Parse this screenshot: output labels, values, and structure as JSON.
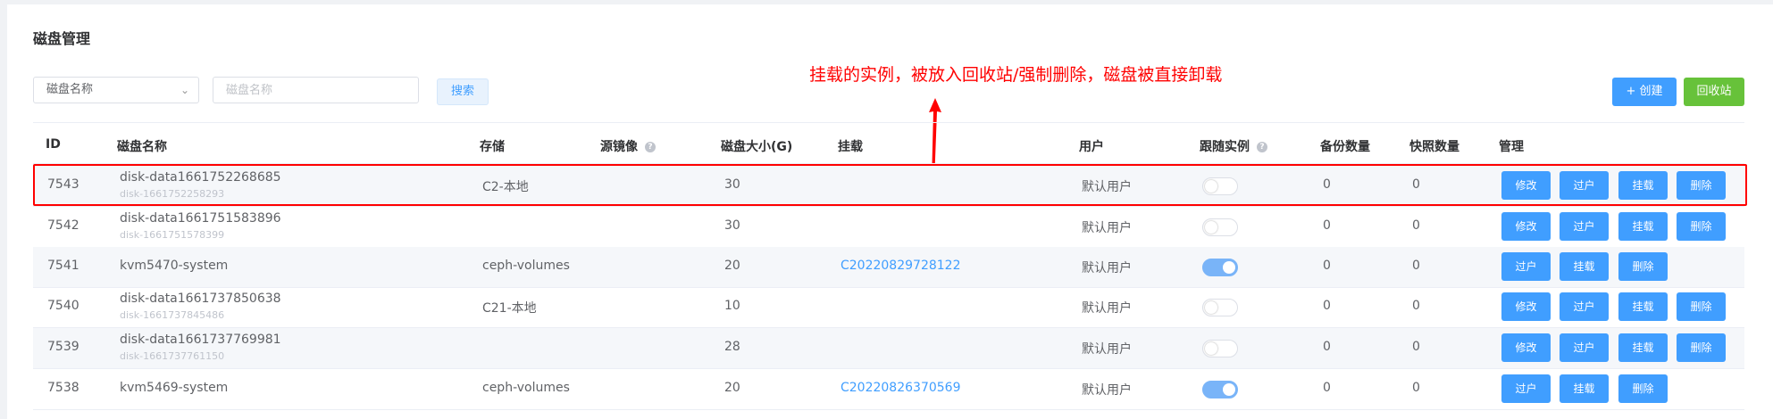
{
  "page": {
    "title": "磁盘管理"
  },
  "filter": {
    "select_value": "磁盘名称",
    "input_placeholder": "磁盘名称",
    "search_label": "搜索"
  },
  "toolbar": {
    "create_label": "+ 创建",
    "recycle_label": "回收站"
  },
  "annotation": {
    "text": "挂载的实例，被放入回收站/强制删除，磁盘被直接卸载",
    "color": "#ff0000"
  },
  "colors": {
    "primary": "#409eff",
    "success": "#67c23a"
  },
  "table": {
    "columns": {
      "id": "ID",
      "name": "磁盘名称",
      "storage": "存储",
      "source": "源镜像",
      "size": "磁盘大小(G)",
      "mount": "挂载",
      "user": "用户",
      "follow": "跟随实例",
      "backup": "备份数量",
      "snapshot": "快照数量",
      "manage": "管理"
    },
    "action_labels": {
      "edit": "修改",
      "transfer": "过户",
      "mount": "挂载",
      "delete": "删除"
    },
    "rows": [
      {
        "id": "7543",
        "name": "disk-data1661752268685",
        "sub": "disk-1661752258293",
        "storage": "C2-本地",
        "size": "30",
        "mount": "",
        "user": "默认用户",
        "follow": false,
        "backup": "0",
        "snapshot": "0",
        "actions": [
          "修改",
          "过户",
          "挂载",
          "删除"
        ]
      },
      {
        "id": "7542",
        "name": "disk-data1661751583896",
        "sub": "disk-1661751578399",
        "storage": "",
        "size": "30",
        "mount": "",
        "user": "默认用户",
        "follow": false,
        "backup": "0",
        "snapshot": "0",
        "actions": [
          "修改",
          "过户",
          "挂载",
          "删除"
        ]
      },
      {
        "id": "7541",
        "name": "kvm5470-system",
        "sub": "",
        "storage": "ceph-volumes",
        "size": "20",
        "mount": "C20220829728122",
        "user": "默认用户",
        "follow": true,
        "backup": "0",
        "snapshot": "0",
        "actions": [
          "过户",
          "挂载",
          "删除"
        ]
      },
      {
        "id": "7540",
        "name": "disk-data1661737850638",
        "sub": "disk-1661737845486",
        "storage": "C21-本地",
        "size": "10",
        "mount": "",
        "user": "默认用户",
        "follow": false,
        "backup": "0",
        "snapshot": "0",
        "actions": [
          "修改",
          "过户",
          "挂载",
          "删除"
        ]
      },
      {
        "id": "7539",
        "name": "disk-data1661737769981",
        "sub": "disk-1661737761150",
        "storage": "",
        "size": "28",
        "mount": "",
        "user": "默认用户",
        "follow": false,
        "backup": "0",
        "snapshot": "0",
        "actions": [
          "修改",
          "过户",
          "挂载",
          "删除"
        ]
      },
      {
        "id": "7538",
        "name": "kvm5469-system",
        "sub": "",
        "storage": "ceph-volumes",
        "size": "20",
        "mount": "C20220826370569",
        "user": "默认用户",
        "follow": true,
        "backup": "0",
        "snapshot": "0",
        "actions": [
          "过户",
          "挂载",
          "删除"
        ]
      }
    ]
  }
}
